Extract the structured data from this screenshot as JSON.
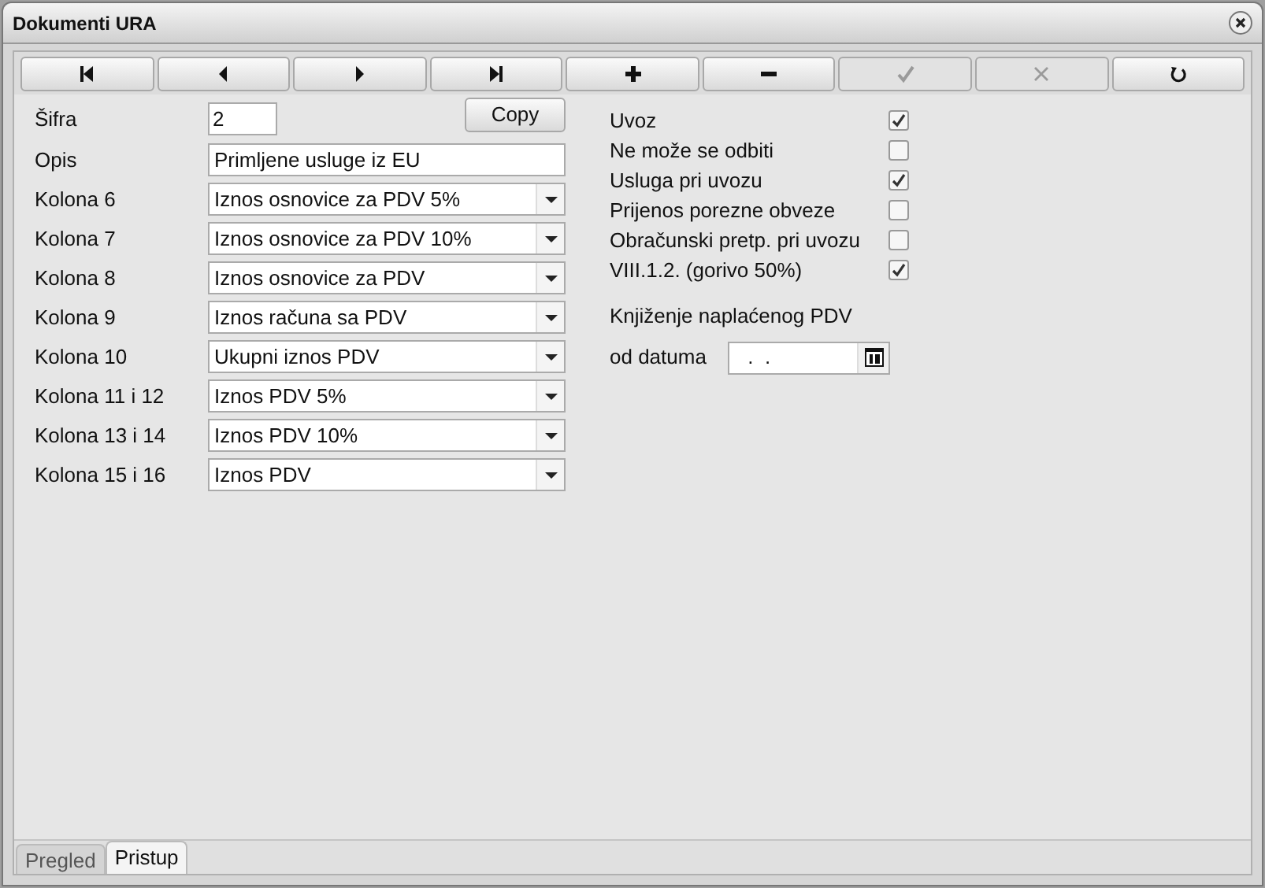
{
  "window": {
    "title": "Dokumenti URA"
  },
  "toolbar": [
    {
      "kind": "first",
      "disabled": false
    },
    {
      "kind": "prev",
      "disabled": false
    },
    {
      "kind": "next",
      "disabled": false
    },
    {
      "kind": "last",
      "disabled": false
    },
    {
      "kind": "add",
      "disabled": false
    },
    {
      "kind": "remove",
      "disabled": false
    },
    {
      "kind": "confirm",
      "disabled": true
    },
    {
      "kind": "cancel",
      "disabled": true
    },
    {
      "kind": "refresh",
      "disabled": false
    }
  ],
  "sifra": {
    "label": "Šifra",
    "value": "2"
  },
  "copy_button": "Copy",
  "opis": {
    "label": "Opis",
    "value": "Primljene usluge iz EU"
  },
  "columns": [
    {
      "label": "Kolona 6",
      "value": "Iznos osnovice za PDV 5%"
    },
    {
      "label": "Kolona 7",
      "value": "Iznos osnovice za PDV 10%"
    },
    {
      "label": "Kolona 8",
      "value": "Iznos osnovice za PDV"
    },
    {
      "label": "Kolona 9",
      "value": "Iznos računa sa PDV"
    },
    {
      "label": "Kolona 10",
      "value": "Ukupni iznos PDV"
    },
    {
      "label": "Kolona 11 i 12",
      "value": "Iznos PDV 5%"
    },
    {
      "label": "Kolona 13 i 14",
      "value": "Iznos PDV 10%"
    },
    {
      "label": "Kolona 15 i 16",
      "value": "Iznos PDV"
    }
  ],
  "options": [
    {
      "label": "Uvoz",
      "checked": true
    },
    {
      "label": "Ne može se odbiti",
      "checked": false
    },
    {
      "label": "Usluga pri uvozu",
      "checked": true
    },
    {
      "label": "Prijenos porezne obveze",
      "checked": false
    },
    {
      "label": "Obračunski pretp. pri uvozu",
      "checked": false
    },
    {
      "label": "VIII.1.2. (gorivo 50%)",
      "checked": true
    }
  ],
  "posting_heading": "Knjiženje naplaćenog PDV",
  "date_field": {
    "label": "od datuma",
    "value": " .  ."
  },
  "tabs": [
    {
      "label": "Pregled",
      "selected": false
    },
    {
      "label": "Pristup",
      "selected": true
    }
  ]
}
